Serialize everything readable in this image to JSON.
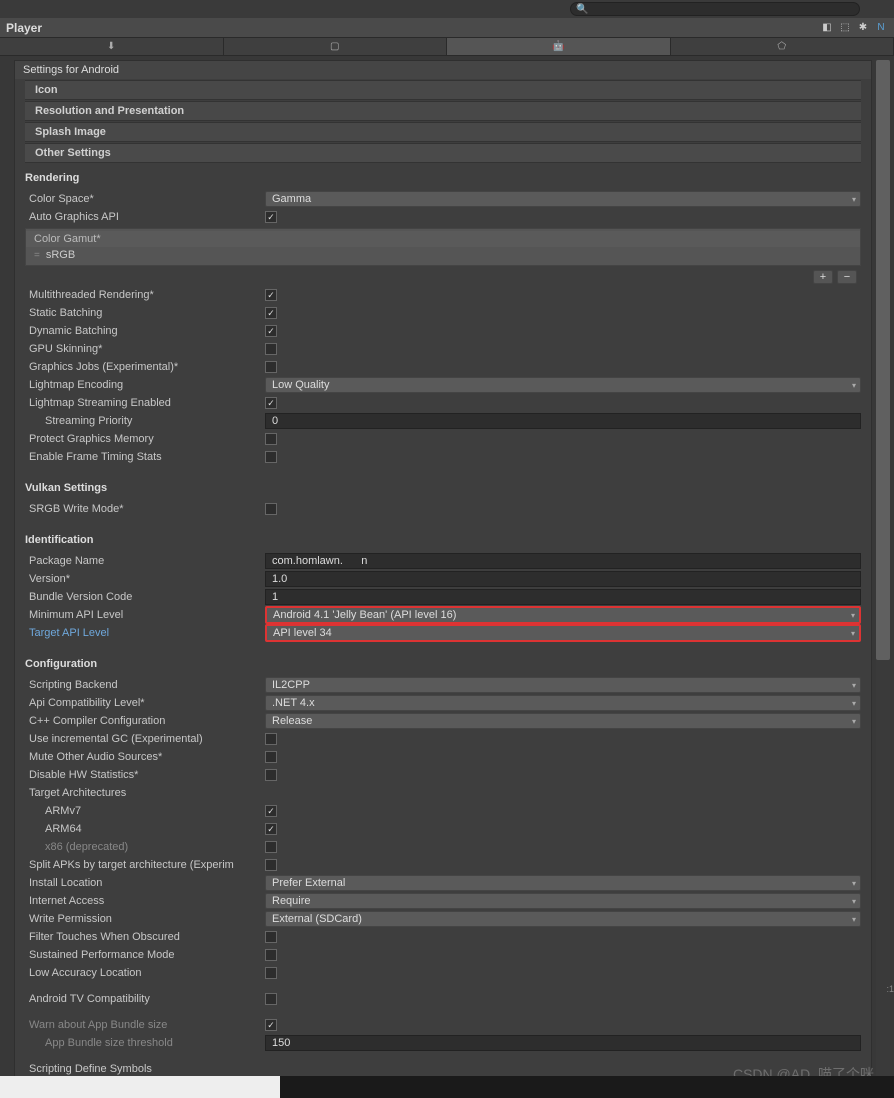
{
  "title": "Player",
  "settings_header": "Settings for Android",
  "sections": {
    "icon": "Icon",
    "resolution": "Resolution and Presentation",
    "splash": "Splash Image",
    "other": "Other Settings"
  },
  "rendering": {
    "title": "Rendering",
    "color_space": {
      "label": "Color Space*",
      "value": "Gamma"
    },
    "auto_graphics_api": {
      "label": "Auto Graphics API",
      "checked": true
    },
    "color_gamut": {
      "header": "Color Gamut*",
      "item": "sRGB"
    },
    "multithreaded": {
      "label": "Multithreaded Rendering*",
      "checked": true
    },
    "static_batching": {
      "label": "Static Batching",
      "checked": true
    },
    "dynamic_batching": {
      "label": "Dynamic Batching",
      "checked": true
    },
    "gpu_skinning": {
      "label": "GPU Skinning*",
      "checked": false
    },
    "graphics_jobs": {
      "label": "Graphics Jobs (Experimental)*",
      "checked": false
    },
    "lightmap_encoding": {
      "label": "Lightmap Encoding",
      "value": "Low Quality"
    },
    "lightmap_streaming": {
      "label": "Lightmap Streaming Enabled",
      "checked": true
    },
    "streaming_priority": {
      "label": "Streaming Priority",
      "value": "0"
    },
    "protect_graphics_memory": {
      "label": "Protect Graphics Memory",
      "checked": false
    },
    "enable_frame_timing": {
      "label": "Enable Frame Timing Stats",
      "checked": false
    }
  },
  "vulkan": {
    "title": "Vulkan Settings",
    "srgb_write": {
      "label": "SRGB Write Mode*",
      "checked": false
    }
  },
  "identification": {
    "title": "Identification",
    "package_name": {
      "label": "Package Name",
      "value": "com.homlawn.      n"
    },
    "version": {
      "label": "Version*",
      "value": "1.0"
    },
    "bundle_version_code": {
      "label": "Bundle Version Code",
      "value": "1"
    },
    "minimum_api": {
      "label": "Minimum API Level",
      "value": "Android 4.1 'Jelly Bean' (API level 16)"
    },
    "target_api": {
      "label": "Target API Level",
      "value": "API level 34"
    }
  },
  "configuration": {
    "title": "Configuration",
    "scripting_backend": {
      "label": "Scripting Backend",
      "value": "IL2CPP"
    },
    "api_compatibility": {
      "label": "Api Compatibility Level*",
      "value": ".NET 4.x"
    },
    "cpp_compiler": {
      "label": "C++ Compiler Configuration",
      "value": "Release"
    },
    "use_incremental_gc": {
      "label": "Use incremental GC (Experimental)",
      "checked": false
    },
    "mute_other_audio": {
      "label": "Mute Other Audio Sources*",
      "checked": false
    },
    "disable_hw_stats": {
      "label": "Disable HW Statistics*",
      "checked": false
    },
    "target_architectures": {
      "label": "Target Architectures"
    },
    "armv7": {
      "label": "ARMv7",
      "checked": true
    },
    "arm64": {
      "label": "ARM64",
      "checked": true
    },
    "x86": {
      "label": "x86 (deprecated)",
      "checked": false
    },
    "split_apks": {
      "label": "Split APKs by target architecture (Experim",
      "checked": false
    },
    "install_location": {
      "label": "Install Location",
      "value": "Prefer External"
    },
    "internet_access": {
      "label": "Internet Access",
      "value": "Require"
    },
    "write_permission": {
      "label": "Write Permission",
      "value": "External (SDCard)"
    },
    "filter_touches": {
      "label": "Filter Touches When Obscured",
      "checked": false
    },
    "sustained_performance": {
      "label": "Sustained Performance Mode",
      "checked": false
    },
    "low_accuracy_location": {
      "label": "Low Accuracy Location",
      "checked": false
    },
    "android_tv": {
      "label": "Android TV Compatibility",
      "checked": false
    },
    "warn_app_bundle": {
      "label": "Warn about App Bundle size",
      "checked": true
    },
    "app_bundle_threshold": {
      "label": "App Bundle size threshold",
      "value": "150"
    },
    "scripting_define": {
      "label": "Scripting Define Symbols"
    }
  },
  "watermark": "CSDN @AD_喵了个咪",
  "side_marker": ":1",
  "colors": {
    "highlight_red": "#d33",
    "highlight_text": "#6fa8dc"
  }
}
